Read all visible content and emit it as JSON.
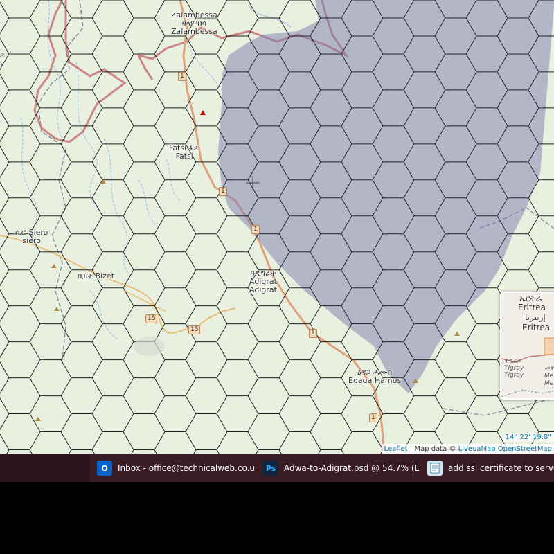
{
  "map": {
    "places": [
      {
        "id": "zalambessa",
        "lines": [
          "Zalambessa",
          "ዛላምበሳ",
          "Zalambessa"
        ]
      },
      {
        "id": "fatsi",
        "lines": [
          "Fatsi ፋጺ",
          "Fatsi"
        ]
      },
      {
        "id": "siero",
        "lines": [
          "ሲሮ Siero",
          "siero"
        ]
      },
      {
        "id": "bizet",
        "lines": [
          "ቢዘት   Bizet"
        ]
      },
      {
        "id": "adigrat",
        "lines": [
          "ዓዲግራት",
          "Adigrat",
          "Adigrat"
        ]
      },
      {
        "id": "edaga-hamus",
        "lines": [
          "ዕዳጋ ሓሙስ",
          "Edaga Hamus"
        ]
      },
      {
        "id": "edge-y",
        "lines": [
          "ේ",
          "y"
        ]
      }
    ],
    "road_shields": [
      "1",
      "1",
      "1",
      "1",
      "15",
      "15",
      "1"
    ],
    "coordinates": "14° 22' 19.8\"",
    "attribution": {
      "leaflet": "Leaflet",
      "sep": " | Map data © ",
      "provider": "LiveuaMap OpenStreetMap"
    }
  },
  "minimap": {
    "labels": [
      "ኤርትራ",
      "Eritrea",
      "إريتريا",
      "Eritrea",
      "ትግራይ",
      "Tigray",
      "Tigray",
      "መቐ",
      "Mek",
      "Mek"
    ]
  },
  "colors": {
    "hex_stroke": "#222222",
    "shaded_zone": "#7b7bb0",
    "road": "#e0a07a",
    "border": "#c77b7b",
    "water": "#9ec6ea",
    "taskbar": "#3a1d24"
  },
  "taskbar": {
    "items": [
      {
        "icon": "outlook-icon",
        "glyph": "O",
        "label": "Inbox - office@technicalweb.co.u..."
      },
      {
        "icon": "photoshop-icon",
        "glyph": "Ps",
        "label": "Adwa-to-Adigrat.psd @ 54.7% (La..."
      },
      {
        "icon": "notepad-icon",
        "glyph": "",
        "label": "add ssl certificate to server - N"
      }
    ]
  }
}
